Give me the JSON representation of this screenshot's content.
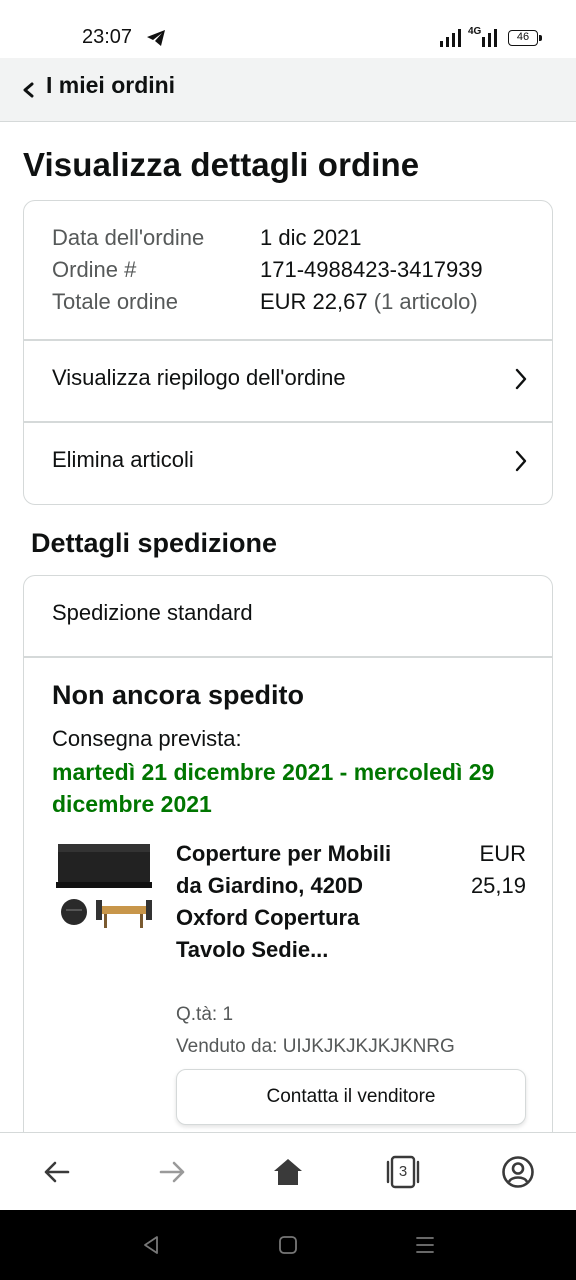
{
  "status_bar": {
    "time": "23:07",
    "network": "4G",
    "battery": "46"
  },
  "nav": {
    "title": "I miei ordini"
  },
  "page_title": "Visualizza dettagli ordine",
  "order": {
    "date_label": "Data dell'ordine",
    "date_value": "1 dic 2021",
    "number_label": "Ordine #",
    "number_value": "171-4988423-3417939",
    "total_label": "Totale ordine",
    "total_value": "EUR 22,67",
    "total_items": "(1 articolo)"
  },
  "links": {
    "summary": "Visualizza riepilogo dell'ordine",
    "delete": "Elimina articoli"
  },
  "shipping": {
    "section_title": "Dettagli spedizione",
    "type": "Spedizione standard",
    "status": "Non ancora spedito",
    "expected_label": "Consegna prevista:",
    "expected_dates": "martedì 21 dicembre 2021 - mercoledì 29 dicembre 2021"
  },
  "product": {
    "title": "Coperture per Mobili da Giardino, 420D Oxford Copertura Tavolo Sedie...",
    "price_currency": "EUR",
    "price_value": "25,19",
    "qty": "Q.tà: 1",
    "seller": "Venduto da: UIJKJKJKJKJKNRG",
    "contact_button": "Contatta il venditore"
  },
  "bottom_bar": {
    "tabs_count": "3"
  },
  "colors": {
    "delivery_green": "#007600",
    "nav_bg": "#f2f3f3",
    "border": "#d5d9d9"
  }
}
